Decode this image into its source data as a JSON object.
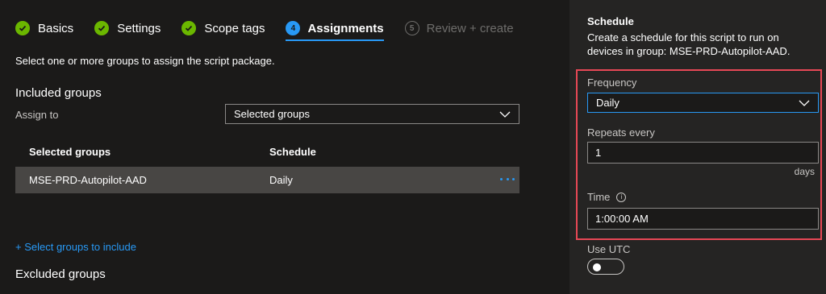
{
  "colors": {
    "accent": "#2899f5",
    "done": "#6bb700",
    "highlight": "#e74856",
    "panel_bg": "#252423",
    "page_bg": "#1b1a19"
  },
  "wizard": {
    "steps": [
      {
        "label": "Basics",
        "state": "done",
        "icon": "checkmark-icon"
      },
      {
        "label": "Settings",
        "state": "done",
        "icon": "checkmark-icon"
      },
      {
        "label": "Scope tags",
        "state": "done",
        "icon": "checkmark-icon"
      },
      {
        "label": "Assignments",
        "state": "current",
        "number": "4"
      },
      {
        "label": "Review + create",
        "state": "future",
        "number": "5"
      }
    ]
  },
  "main": {
    "intro": "Select one or more groups to assign the script package.",
    "included_title": "Included groups",
    "assign_to_label": "Assign to",
    "assign_to_value": "Selected groups",
    "table": {
      "headers": [
        "Selected groups",
        "Schedule"
      ],
      "rows": [
        {
          "group": "MSE-PRD-Autopilot-AAD",
          "schedule": "Daily"
        }
      ]
    },
    "select_groups_link": "+ Select groups to include",
    "excluded_title": "Excluded groups"
  },
  "panel": {
    "title": "Schedule",
    "description": "Create a schedule for this script to run on devices in group: MSE-PRD-Autopilot-AAD.",
    "frequency_label": "Frequency",
    "frequency_value": "Daily",
    "repeats_label": "Repeats every",
    "repeats_value": "1",
    "repeats_unit": "days",
    "time_label": "Time",
    "time_value": "1:00:00 AM",
    "utc_label": "Use UTC",
    "utc_on": false
  }
}
